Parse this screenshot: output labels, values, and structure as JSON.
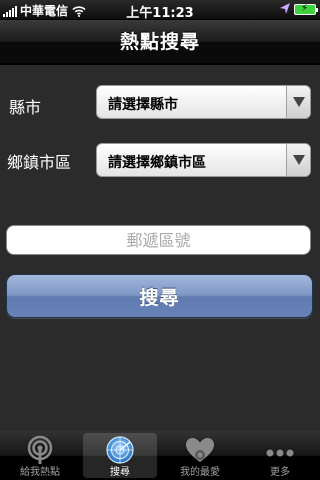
{
  "status_bar": {
    "carrier": "中華電信",
    "time": "上午11:23"
  },
  "nav": {
    "title": "熱點搜尋"
  },
  "form": {
    "county_label": "縣市",
    "county_value": "請選擇縣市",
    "district_label": "鄉鎮市區",
    "district_value": "請選擇鄉鎮市區",
    "zip_placeholder": "郵遞區號",
    "search_label": "搜尋"
  },
  "tabs": [
    {
      "label": "給我熱點",
      "icon": "hotspot-icon",
      "selected": false
    },
    {
      "label": "搜尋",
      "icon": "radar-search-icon",
      "selected": true
    },
    {
      "label": "我的最愛",
      "icon": "favorite-heart-icon",
      "selected": false
    },
    {
      "label": "更多",
      "icon": "more-dots-icon",
      "selected": false
    }
  ],
  "colors": {
    "background": "#2b2b2b",
    "button_blue": "#7d97c6",
    "tab_selected": "#4a90d9"
  }
}
